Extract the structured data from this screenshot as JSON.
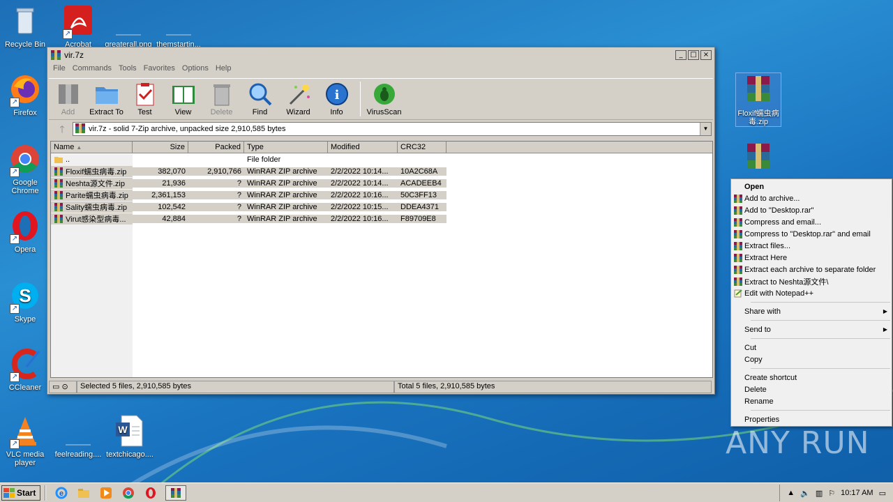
{
  "desktop": {
    "icons_left": [
      {
        "label": "Recycle Bin"
      },
      {
        "label": "Acrobat"
      },
      {
        "label": "greaterall.png"
      },
      {
        "label": "themstartin..."
      },
      {
        "label": "Firefox"
      },
      {
        "label": "Google Chrome"
      },
      {
        "label": "Opera"
      },
      {
        "label": "Skype"
      },
      {
        "label": "CCleaner"
      },
      {
        "label": "VLC media player"
      },
      {
        "label": "feelreading...."
      },
      {
        "label": "textchicago...."
      }
    ],
    "icons_right": [
      {
        "label": "Floxif蠕虫病毒.zip"
      }
    ]
  },
  "window": {
    "title": "vir.7z",
    "controls": {
      "minimize": "_",
      "maximize": "□",
      "close": "×"
    },
    "menu": [
      "File",
      "Commands",
      "Tools",
      "Favorites",
      "Options",
      "Help"
    ],
    "toolbar": [
      {
        "label": "Add",
        "icon": "add-icon",
        "enabled": false
      },
      {
        "label": "Extract To",
        "icon": "folder-icon",
        "enabled": true
      },
      {
        "label": "Test",
        "icon": "clipboard-check-icon",
        "enabled": true
      },
      {
        "label": "View",
        "icon": "book-icon",
        "enabled": true
      },
      {
        "label": "Delete",
        "icon": "trash-icon",
        "enabled": false
      },
      {
        "label": "Find",
        "icon": "magnifier-icon",
        "enabled": true
      },
      {
        "label": "Wizard",
        "icon": "wand-icon",
        "enabled": true
      },
      {
        "label": "Info",
        "icon": "info-icon",
        "enabled": true
      },
      {
        "label": "VirusScan",
        "icon": "bug-icon",
        "enabled": true
      }
    ],
    "address": "vir.7z - solid 7-Zip archive, unpacked size 2,910,585 bytes",
    "columns": [
      "Name",
      "Size",
      "Packed",
      "Type",
      "Modified",
      "CRC32"
    ],
    "rows": [
      {
        "name": "..",
        "size": "",
        "packed": "",
        "type": "File folder",
        "modified": "",
        "crc": "",
        "kind": "folder"
      },
      {
        "name": "Floxif蠕虫病毒.zip",
        "size": "382,070",
        "packed": "2,910,766",
        "type": "WinRAR ZIP archive",
        "modified": "2/2/2022 10:14...",
        "crc": "10A2C68A",
        "kind": "archive"
      },
      {
        "name": "Neshta源文件.zip",
        "size": "21,936",
        "packed": "?",
        "type": "WinRAR ZIP archive",
        "modified": "2/2/2022 10:14...",
        "crc": "ACADEEB4",
        "kind": "archive"
      },
      {
        "name": "Parite蠕虫病毒.zip",
        "size": "2,361,153",
        "packed": "?",
        "type": "WinRAR ZIP archive",
        "modified": "2/2/2022 10:16...",
        "crc": "50C3FF13",
        "kind": "archive"
      },
      {
        "name": "Sality蠕虫病毒.zip",
        "size": "102,542",
        "packed": "?",
        "type": "WinRAR ZIP archive",
        "modified": "2/2/2022 10:15...",
        "crc": "DDEA4371",
        "kind": "archive"
      },
      {
        "name": "Virut感染型病毒...",
        "size": "42,884",
        "packed": "?",
        "type": "WinRAR ZIP archive",
        "modified": "2/2/2022 10:16...",
        "crc": "F89709E8",
        "kind": "archive"
      }
    ],
    "status_left": "Selected 5 files, 2,910,585 bytes",
    "status_right": "Total 5 files, 2,910,585 bytes"
  },
  "context_menu": {
    "groups": [
      [
        {
          "label": "Open",
          "bold": true,
          "icon": "none"
        },
        {
          "label": "Add to archive...",
          "icon": "winrar-icon"
        },
        {
          "label": "Add to \"Desktop.rar\"",
          "icon": "winrar-icon"
        },
        {
          "label": "Compress and email...",
          "icon": "winrar-icon"
        },
        {
          "label": "Compress to \"Desktop.rar\" and email",
          "icon": "winrar-icon"
        },
        {
          "label": "Extract files...",
          "icon": "winrar-icon"
        },
        {
          "label": "Extract Here",
          "icon": "winrar-icon"
        },
        {
          "label": "Extract each archive to separate folder",
          "icon": "winrar-icon"
        },
        {
          "label": "Extract to Neshta源文件\\",
          "icon": "winrar-icon"
        },
        {
          "label": "Edit with Notepad++",
          "icon": "notepad-icon"
        }
      ],
      [
        {
          "label": "Share with",
          "submenu": true,
          "icon": "none"
        }
      ],
      [
        {
          "label": "Send to",
          "submenu": true,
          "icon": "none"
        }
      ],
      [
        {
          "label": "Cut",
          "icon": "none"
        },
        {
          "label": "Copy",
          "icon": "none"
        }
      ],
      [
        {
          "label": "Create shortcut",
          "icon": "none"
        },
        {
          "label": "Delete",
          "icon": "none"
        },
        {
          "label": "Rename",
          "icon": "none"
        }
      ],
      [
        {
          "label": "Properties",
          "icon": "none"
        }
      ]
    ]
  },
  "taskbar": {
    "start": "Start",
    "pinned": [
      "ie-icon",
      "explorer-icon",
      "media-player-icon",
      "chrome-icon",
      "opera-icon",
      "winrar-icon"
    ],
    "clock": "10:17 AM"
  },
  "watermark": "ANY RUN"
}
